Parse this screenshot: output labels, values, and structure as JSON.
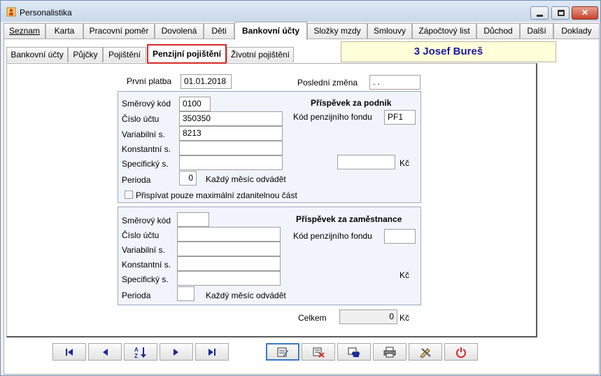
{
  "window": {
    "title": "Personalistika",
    "minimize_glyph": "",
    "maximize_glyph": "",
    "close_glyph": "✕"
  },
  "main_tabs": [
    {
      "label": "Seznam",
      "active": false
    },
    {
      "label": "Karta",
      "active": false
    },
    {
      "label": "Pracovní poměr",
      "active": false
    },
    {
      "label": "Dovolená",
      "active": false
    },
    {
      "label": "Děti",
      "active": false
    },
    {
      "label": "Bankovní účty",
      "active": true
    },
    {
      "label": "Složky mzdy",
      "active": false
    },
    {
      "label": "Smlouvy",
      "active": false
    },
    {
      "label": "Zápočtový list",
      "active": false
    },
    {
      "label": "Důchod",
      "active": false
    },
    {
      "label": "Další",
      "active": false
    },
    {
      "label": "Doklady",
      "active": false
    }
  ],
  "sub_tabs": [
    {
      "label": "Bankovní účty",
      "active": false
    },
    {
      "label": "Půjčky",
      "active": false
    },
    {
      "label": "Pojištění",
      "active": false
    },
    {
      "label": "Penzijní pojištění",
      "active": true
    },
    {
      "label": "Životní pojištění",
      "active": false
    }
  ],
  "employee": {
    "name": "3 Josef Bureš"
  },
  "top": {
    "first_payment_label": "První platba",
    "first_payment_value": "01.01.2018",
    "last_change_label": "Poslední změna",
    "last_change_value": " .  ."
  },
  "company": {
    "heading": "Příspěvek za podnik",
    "bank_code_label": "Směrový kód",
    "bank_code_value": "0100",
    "account_label": "Číslo účtu",
    "account_value": "350350",
    "variable_label": "Variabilní s.",
    "variable_value": "8213",
    "constant_label": "Konstantní s.",
    "constant_value": "",
    "specific_label": "Specifický s.",
    "specific_value": "",
    "period_label": "Perioda",
    "period_value": "0",
    "period_text": "Každý měsíc odvádět",
    "fund_label": "Kód penzijního fondu",
    "fund_value": "PF1",
    "amount_value": "",
    "currency": "Kč",
    "max_checkbox_label": "Přispívat pouze maximální zdanitelnou část",
    "max_checked": false
  },
  "employee_contrib": {
    "heading": "Příspěvek za zaměstnance",
    "bank_code_label": "Směrový kód",
    "bank_code_value": "",
    "account_label": "Číslo účtu",
    "account_value": "",
    "variable_label": "Variabilní s.",
    "variable_value": "",
    "constant_label": "Konstantní s.",
    "constant_value": "",
    "specific_label": "Specifický s.",
    "specific_value": "",
    "period_label": "Perioda",
    "period_value": "",
    "period_text": "Každý měsíc odvádět",
    "fund_label": "Kód penzijního fondu",
    "fund_value": "",
    "currency": "Kč"
  },
  "total": {
    "label": "Celkem",
    "value": "0",
    "currency": "Kč"
  },
  "toolbar": {
    "icons": [
      "first-record-icon",
      "previous-record-icon",
      "sort-icon",
      "next-record-icon",
      "last-record-icon",
      "edit-icon",
      "delete-icon",
      "search-icon",
      "print-icon",
      "tools-icon",
      "power-icon"
    ],
    "accent_red": "#d62a2a",
    "accent_blue": "#1a1aa0"
  }
}
